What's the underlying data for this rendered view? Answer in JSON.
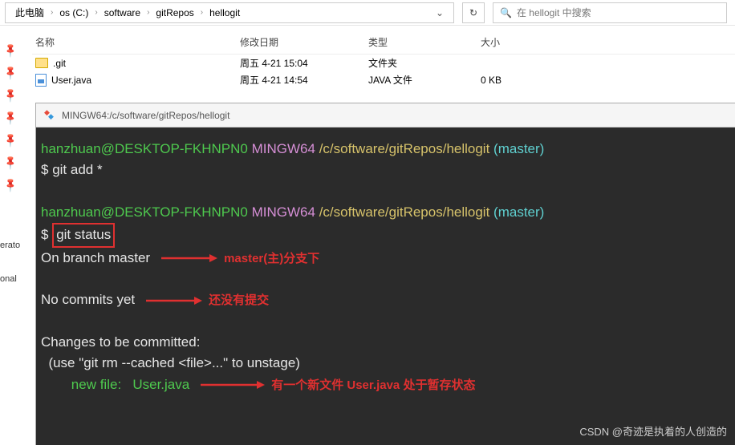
{
  "breadcrumb": {
    "items": [
      "此电脑",
      "os (C:)",
      "software",
      "gitRepos",
      "hellogit"
    ]
  },
  "search": {
    "placeholder": "在 hellogit 中搜索"
  },
  "columns": {
    "name": "名称",
    "date": "修改日期",
    "type": "类型",
    "size": "大小"
  },
  "files": [
    {
      "name": ".git",
      "date": "周五 4-21 15:04",
      "type": "文件夹",
      "size": ""
    },
    {
      "name": "User.java",
      "date": "周五 4-21 14:54",
      "type": "JAVA 文件",
      "size": "0 KB"
    }
  ],
  "left": {
    "l1": "erato",
    "l2": "onal"
  },
  "terminal": {
    "title": "MINGW64:/c/software/gitRepos/hellogit",
    "user": "hanzhuan@DESKTOP-FKHNPN0",
    "env": "MINGW64",
    "path": "/c/software/gitRepos/hellogit",
    "branch": "(master)",
    "prompt": "$",
    "cmd1": "git add *",
    "cmd2": "git status",
    "out1": "On branch master",
    "ann1": "master(主)分支下",
    "out2": "No commits yet",
    "ann2": "还没有提交",
    "out3": "Changes to be committed:",
    "out4": "  (use \"git rm --cached <file>...\" to unstage)",
    "out5_label": "new file:",
    "out5_file": "User.java",
    "ann3": "有一个新文件 User.java 处于暂存状态"
  },
  "watermark": "CSDN @奇迹是执着的人创造的"
}
